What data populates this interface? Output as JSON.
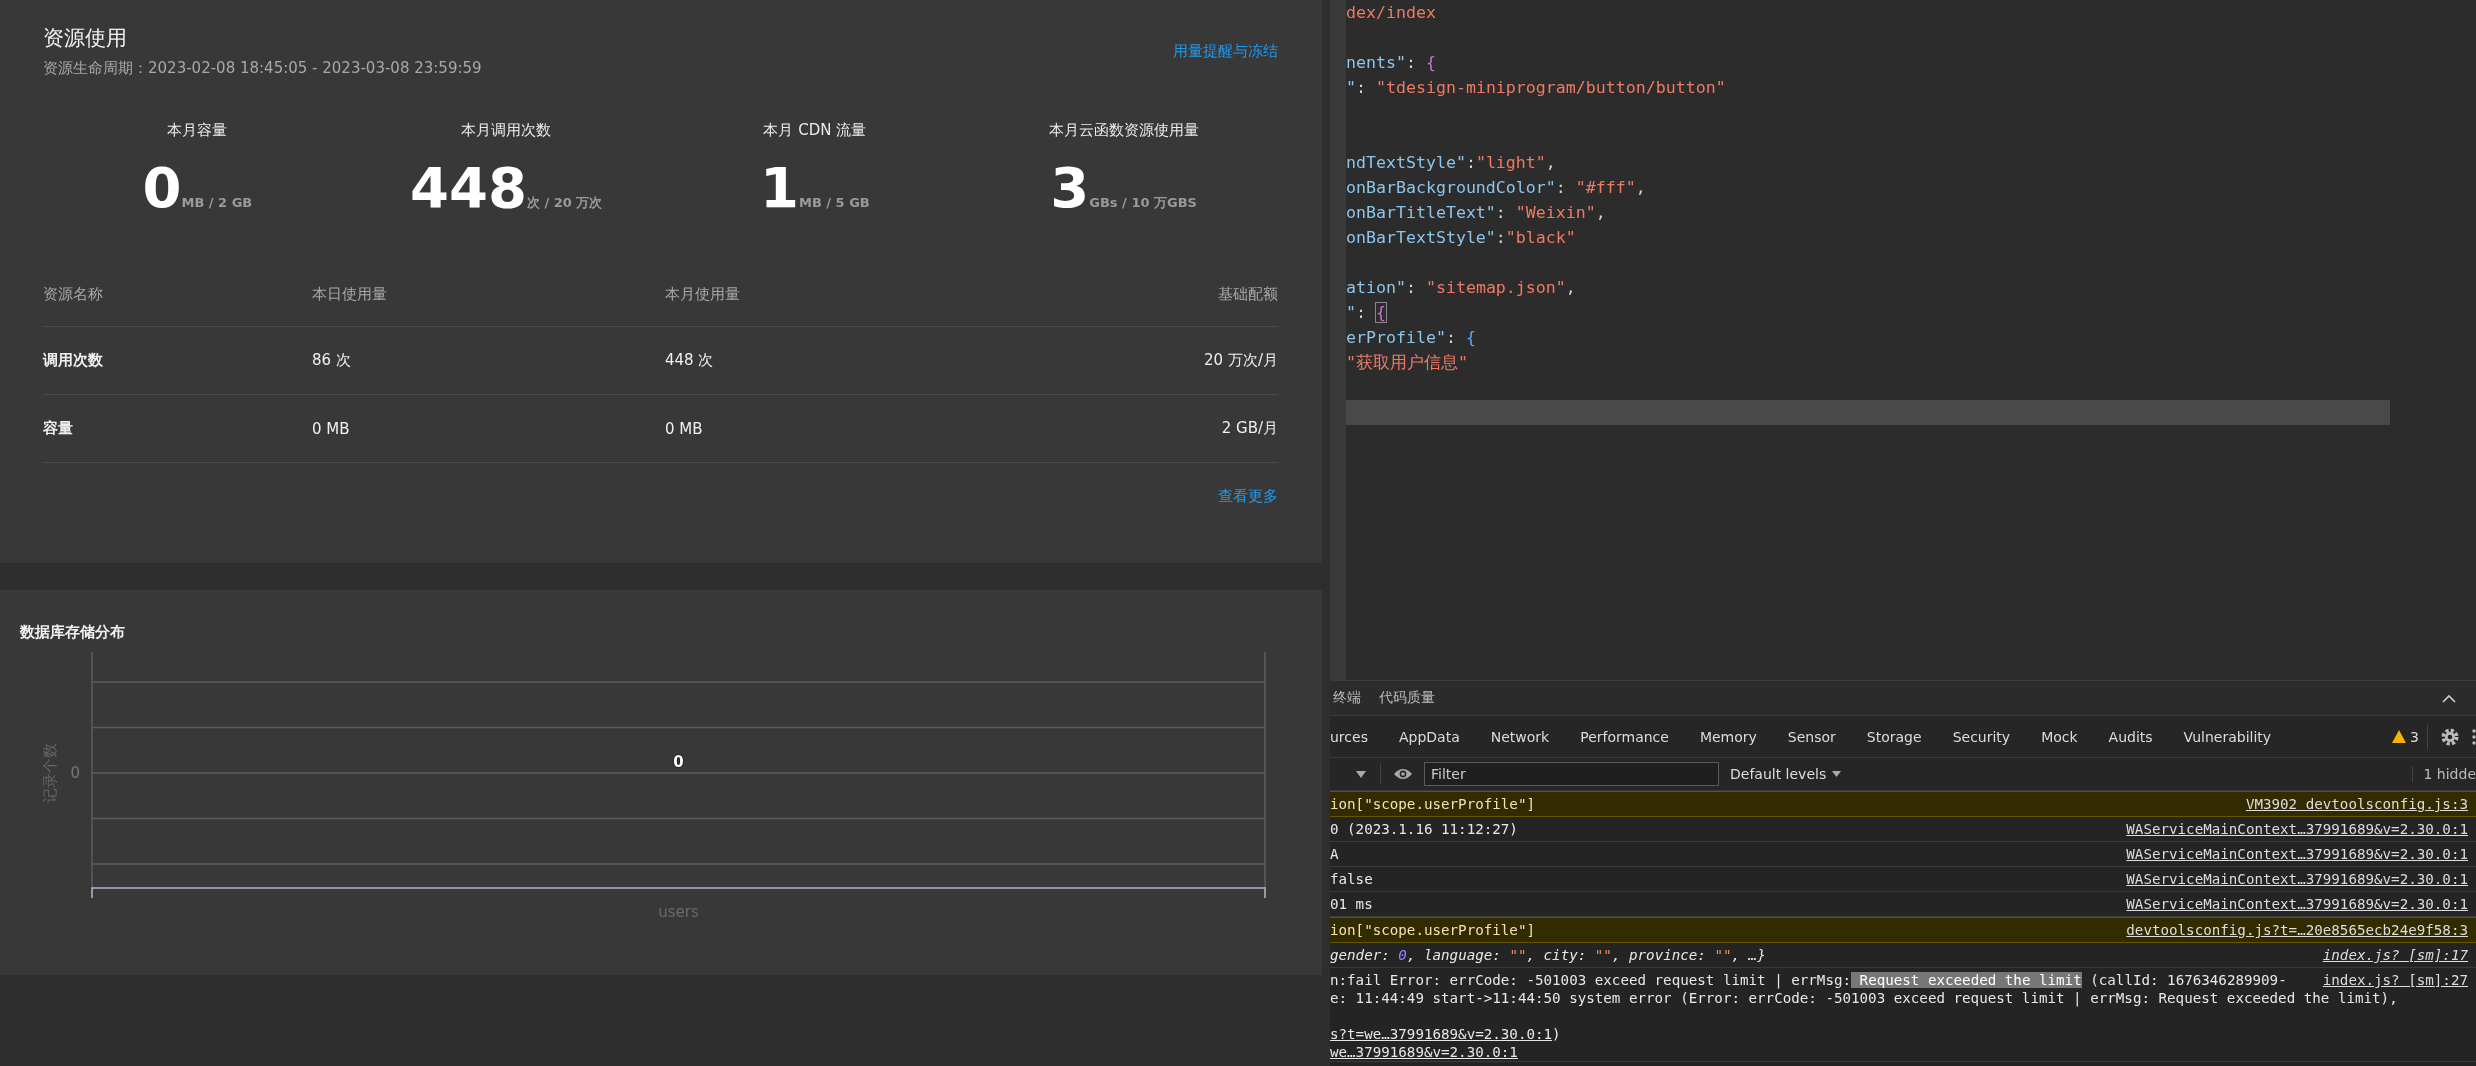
{
  "resource_usage": {
    "title": "资源使用",
    "period": "资源生命周期：2023-02-08 18:45:05 - 2023-03-08 23:59:59",
    "alert_link": "用量提醒与冻结",
    "stats": [
      {
        "label": "本月容量",
        "value": "0",
        "unit": "MB / 2 GB"
      },
      {
        "label": "本月调用次数",
        "value": "448",
        "unit": "次 / 20 万次"
      },
      {
        "label": "本月 CDN 流量",
        "value": "1",
        "unit": "MB / 5 GB"
      },
      {
        "label": "本月云函数资源使用量",
        "value": "3",
        "unit": "GBs / 10 万GBS"
      }
    ],
    "table": {
      "columns": [
        "资源名称",
        "本日使用量",
        "本月使用量",
        "基础配额"
      ],
      "rows": [
        [
          "调用次数",
          "86 次",
          "448 次",
          "20 万次/月"
        ],
        [
          "容量",
          "0 MB",
          "0 MB",
          "2 GB/月"
        ]
      ]
    },
    "more_link": "查看更多"
  },
  "db_storage": {
    "title": "数据库存储分布",
    "y_axis_label": "记录个数",
    "y_tick_label": "0",
    "data_label": "0",
    "category_label": "users"
  },
  "editor": {
    "lines": [
      {
        "kind": "code",
        "tokens": [
          {
            "kind": "string",
            "text": "dex/index"
          }
        ]
      },
      {
        "kind": "blank"
      },
      {
        "kind": "code",
        "tokens": [
          {
            "kind": "key",
            "text": "nents\""
          },
          {
            "kind": "punct",
            "text": ": "
          },
          {
            "kind": "brace",
            "text": "{"
          }
        ]
      },
      {
        "kind": "code",
        "tokens": [
          {
            "kind": "key",
            "text": "\""
          },
          {
            "kind": "punct",
            "text": ": "
          },
          {
            "kind": "string",
            "text": "\"tdesign-miniprogram/button/button\""
          }
        ]
      },
      {
        "kind": "blank"
      },
      {
        "kind": "blank"
      },
      {
        "kind": "code",
        "tokens": [
          {
            "kind": "key",
            "text": "ndTextStyle\""
          },
          {
            "kind": "punct",
            "text": ":"
          },
          {
            "kind": "string",
            "text": "\"light\""
          },
          {
            "kind": "punct",
            "text": ","
          }
        ]
      },
      {
        "kind": "code",
        "tokens": [
          {
            "kind": "key",
            "text": "onBarBackgroundColor\""
          },
          {
            "kind": "punct",
            "text": ": "
          },
          {
            "kind": "string",
            "text": "\"#fff\""
          },
          {
            "kind": "punct",
            "text": ","
          }
        ]
      },
      {
        "kind": "code",
        "tokens": [
          {
            "kind": "key",
            "text": "onBarTitleText\""
          },
          {
            "kind": "punct",
            "text": ": "
          },
          {
            "kind": "string",
            "text": "\"Weixin\""
          },
          {
            "kind": "punct",
            "text": ","
          }
        ]
      },
      {
        "kind": "code",
        "tokens": [
          {
            "kind": "key",
            "text": "onBarTextStyle\""
          },
          {
            "kind": "punct",
            "text": ":"
          },
          {
            "kind": "string",
            "text": "\"black\""
          }
        ]
      },
      {
        "kind": "blank"
      },
      {
        "kind": "code",
        "tokens": [
          {
            "kind": "key",
            "text": "ation\""
          },
          {
            "kind": "punct",
            "text": ": "
          },
          {
            "kind": "string",
            "text": "\"sitemap.json\""
          },
          {
            "kind": "punct",
            "text": ","
          }
        ]
      },
      {
        "kind": "code",
        "tokens": [
          {
            "kind": "key",
            "text": "\""
          },
          {
            "kind": "punct",
            "text": ": "
          },
          {
            "kind": "brace_match",
            "text": "{"
          }
        ]
      },
      {
        "kind": "code",
        "tokens": [
          {
            "kind": "key",
            "text": "erProfile\""
          },
          {
            "kind": "punct",
            "text": ": "
          },
          {
            "kind": "brace_inner",
            "text": "{"
          }
        ]
      },
      {
        "kind": "code",
        "tokens": [
          {
            "kind": "string",
            "text": "\"获取用户信息\""
          }
        ]
      },
      {
        "kind": "blank"
      },
      {
        "kind": "current"
      }
    ]
  },
  "devtools": {
    "drawer_tabs": [
      "终端",
      "代码质量"
    ],
    "panel_tabs": [
      "urces",
      "AppData",
      "Network",
      "Performance",
      "Memory",
      "Sensor",
      "Storage",
      "Security",
      "Mock",
      "Audits",
      "Vulnerability"
    ],
    "warning_count": "3",
    "filter": {
      "placeholder": "Filter"
    },
    "levels": "Default levels",
    "hidden": "1 hidde",
    "console": [
      {
        "kind": "warning",
        "lines": [
          {
            "kind": "text",
            "tokens": [
              {
                "kind": "plain",
                "text": "ion[\"scope.userProfile\"]"
              }
            ]
          }
        ],
        "source": "VM3902 devtoolsconfig.js:3"
      },
      {
        "kind": "log",
        "lines": [
          {
            "kind": "text",
            "tokens": [
              {
                "kind": "plain",
                "text": "0 (2023.1.16 11:12:27)"
              }
            ]
          }
        ],
        "source": "WAServiceMainContext…37991689&v=2.30.0:1"
      },
      {
        "kind": "log",
        "lines": [
          {
            "kind": "text",
            "tokens": [
              {
                "kind": "plain",
                "text": "A"
              }
            ]
          }
        ],
        "source": "WAServiceMainContext…37991689&v=2.30.0:1"
      },
      {
        "kind": "log",
        "lines": [
          {
            "kind": "text",
            "tokens": [
              {
                "kind": "plain",
                "text": "false"
              }
            ]
          }
        ],
        "source": "WAServiceMainContext…37991689&v=2.30.0:1"
      },
      {
        "kind": "log",
        "lines": [
          {
            "kind": "text",
            "tokens": [
              {
                "kind": "plain",
                "text": "01 ms"
              }
            ]
          }
        ],
        "source": "WAServiceMainContext…37991689&v=2.30.0:1"
      },
      {
        "kind": "warning",
        "lines": [
          {
            "kind": "text",
            "tokens": [
              {
                "kind": "plain",
                "text": "ion[\"scope.userProfile\"]"
              }
            ]
          }
        ],
        "source": "devtoolsconfig.js?t=…20e8565ecb24e9f58:3"
      },
      {
        "kind": "object",
        "lines": [
          {
            "kind": "text",
            "tokens": [
              {
                "kind": "plain",
                "text": "gender: "
              },
              {
                "kind": "number",
                "text": "0"
              },
              {
                "kind": "plain",
                "text": ", language: "
              },
              {
                "kind": "string",
                "text": "\"\""
              },
              {
                "kind": "plain",
                "text": ", city: "
              },
              {
                "kind": "string",
                "text": "\"\""
              },
              {
                "kind": "plain",
                "text": ", province: "
              },
              {
                "kind": "string",
                "text": "\"\""
              },
              {
                "kind": "plain",
                "text": ", …}"
              }
            ]
          }
        ],
        "source": "index.js? [sm]:17"
      },
      {
        "kind": "error",
        "lines": [
          {
            "kind": "text",
            "tokens": [
              {
                "kind": "plain",
                "text": "n:fail Error: errCode: -501003 exceed request limit | errMsg:"
              },
              {
                "kind": "highlight",
                "text": " Request exceeded the limit"
              },
              {
                "kind": "plain",
                "text": " (callId: 1676346289909-"
              }
            ]
          },
          {
            "kind": "text",
            "tokens": [
              {
                "kind": "plain",
                "text": "e: 11:44:49 start->11:44:50 system error (Error: errCode: -501003 exceed request limit | errMsg: Request exceeded the limit),"
              }
            ]
          },
          {
            "kind": "blank"
          },
          {
            "kind": "text",
            "tokens": [
              {
                "kind": "link",
                "text": "s?t=we…37991689&v=2.30.0:1"
              },
              {
                "kind": "plain",
                "text": ")"
              }
            ]
          },
          {
            "kind": "text",
            "tokens": [
              {
                "kind": "link",
                "text": "we…37991689&v=2.30.0:1"
              }
            ]
          }
        ],
        "source": "index.js? [sm]:27"
      }
    ]
  }
}
